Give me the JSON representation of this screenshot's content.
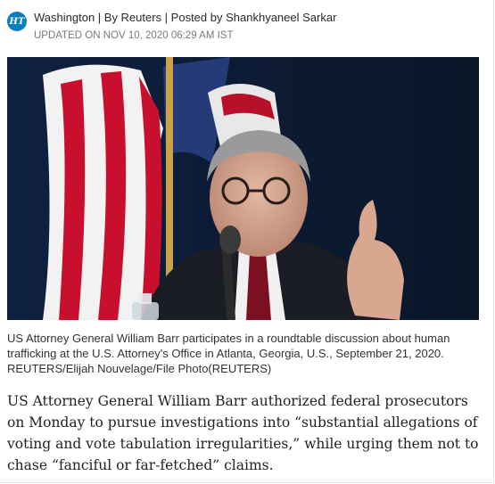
{
  "header": {
    "logo_text": "HT",
    "byline": "Washington | By Reuters | Posted by Shankhyaneel Sarkar",
    "updated": "UPDATED ON NOV 10, 2020 06:29 AM IST"
  },
  "photo": {
    "caption": "US Attorney General William Barr participates in a roundtable discussion about human trafficking at the U.S. Attorney's Office in Atlanta, Georgia, U.S., September 21, 2020. REUTERS/Elijah Nouvelage/File Photo(REUTERS)"
  },
  "article": {
    "lede": "US Attorney General William Barr authorized federal prosecutors on Monday to pursue investigations into “substantial allegations of voting and vote tabulation irregularities,” while urging them not to chase “fanciful or far-fetched” claims."
  },
  "colors": {
    "logo_bg": "#0a7dbf",
    "photo_bg": "#0d1c33"
  }
}
